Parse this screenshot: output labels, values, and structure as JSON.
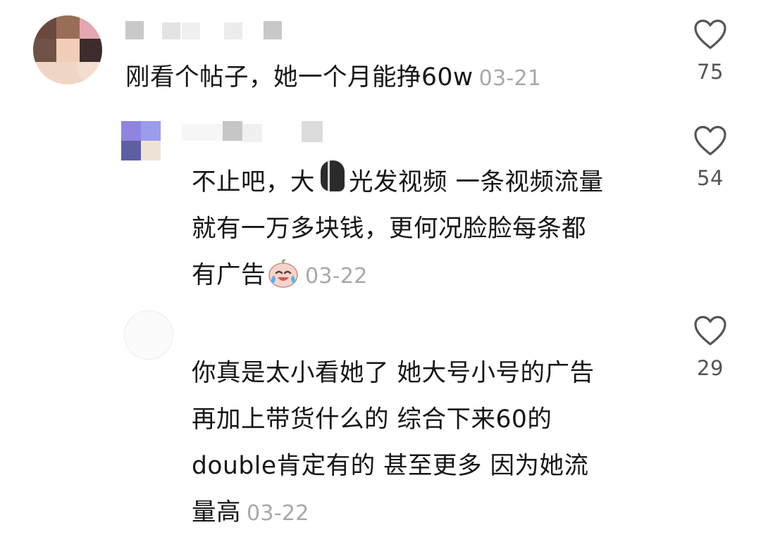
{
  "comments": [
    {
      "text": "刚看个帖子，她一个月能挣60w",
      "time": "03-21",
      "likes": "75",
      "avatar": "avatar-mosaic-girl"
    },
    {
      "text_part1": "不止吧，大",
      "text_part2": "光发视频 一条视频流量",
      "line2": "就有一万多块钱，更何况脸脸每条都",
      "line3": "有广告",
      "emoji": "crying-laughing-emoji",
      "time": "03-22",
      "likes": "54"
    },
    {
      "line1": "你真是太小看她了  她大号小号的广告",
      "line2": "再加上带货什么的 综合下来60的",
      "line3": "double肯定有的  甚至更多  因为她流",
      "line4": "量高",
      "time": "03-22",
      "likes": "29"
    }
  ],
  "icons": {
    "like": "heart-outline-icon"
  },
  "colors": {
    "text": "#161616",
    "timestamp": "#a8a8a8",
    "like_count": "#555555"
  }
}
